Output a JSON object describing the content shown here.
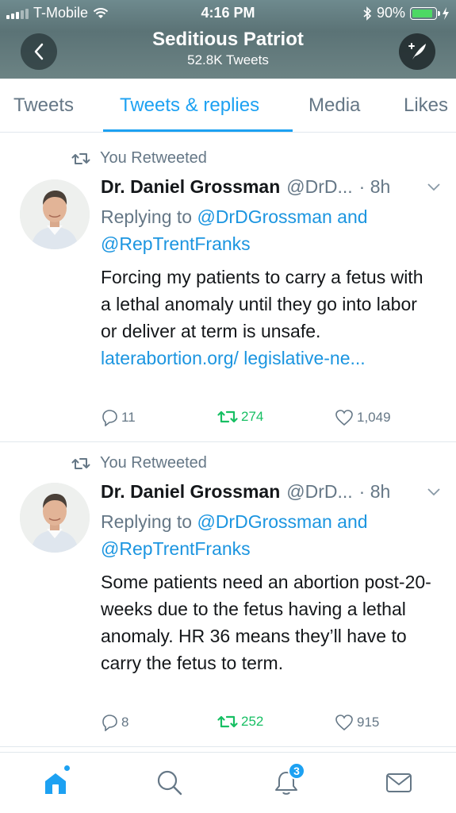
{
  "status_bar": {
    "carrier": "T-Mobile",
    "time": "4:16 PM",
    "battery": "90%",
    "battery_level": 0.9
  },
  "header": {
    "title": "Seditious Patriot",
    "subtitle": "52.8K Tweets"
  },
  "tabs": [
    {
      "label": "Tweets"
    },
    {
      "label": "Tweets & replies"
    },
    {
      "label": "Media"
    },
    {
      "label": "Likes"
    }
  ],
  "active_tab": "Tweets & replies",
  "tweets": [
    {
      "retweet_label": "You Retweeted",
      "name": "Dr. Daniel Grossman",
      "handle": "@DrD...",
      "time": "· 8h",
      "reply_prefix": "Replying to ",
      "reply_to_1": "@DrDGrossman",
      "reply_and": " and",
      "reply_to_2": "@RepTrentFranks",
      "text": "Forcing my patients to carry a fetus with a lethal anomaly until they go into labor or deliver at term is unsafe. ",
      "link": "laterabortion.org/ legislative-ne...",
      "replies": "11",
      "retweets": "274",
      "likes": "1,049"
    },
    {
      "retweet_label": "You Retweeted",
      "name": "Dr. Daniel Grossman",
      "handle": "@DrD...",
      "time": "· 8h",
      "reply_prefix": "Replying to ",
      "reply_to_1": "@DrDGrossman",
      "reply_and": " and",
      "reply_to_2": "@RepTrentFranks",
      "text": "Some patients need an abortion post-20-weeks due to the fetus having a lethal anomaly. HR 36 means they’ll have to carry the fetus to term.",
      "replies": "8",
      "retweets": "252",
      "likes": "915"
    }
  ],
  "bottom_nav": {
    "notifications_badge": "3"
  },
  "icons": [
    "back-arrow-icon",
    "compose-tweet-icon",
    "retweet-icon",
    "chevron-down-icon",
    "reply-icon",
    "heart-icon",
    "home-icon",
    "search-icon",
    "bell-icon",
    "mail-icon",
    "wifi-icon",
    "bluetooth-icon",
    "battery-icon",
    "charging-icon"
  ],
  "colors": {
    "accent": "#1da1f2",
    "link": "#1b95e0",
    "retweet_green": "#17bf63",
    "muted": "#657786"
  }
}
